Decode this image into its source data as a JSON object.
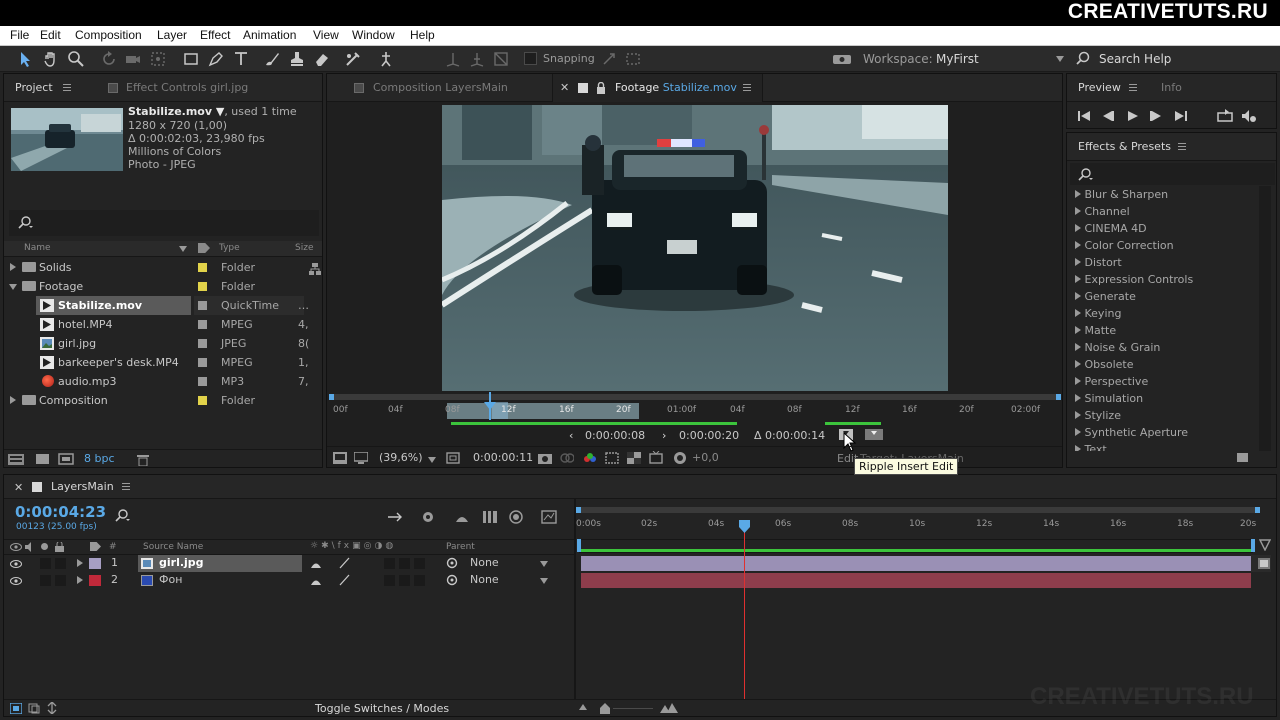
{
  "brand": "CREATIVETUTS.RU",
  "watermark": "CREATIVETUTS.RU",
  "menu": [
    "File",
    "Edit",
    "Composition",
    "Layer",
    "Effect",
    "Animation",
    "View",
    "Window",
    "Help"
  ],
  "toolbar": {
    "snapping": "Snapping",
    "workspace_label": "Workspace:",
    "workspace_value": "MyFirst",
    "search_help": "Search Help"
  },
  "project": {
    "tab_project": "Project",
    "tab_effect_controls": "Effect Controls girl.jpg",
    "selected_name": "Stabilize.mov ▼",
    "used": ", used 1 time",
    "info_lines": [
      "1280 x 720 (1,00)",
      "Δ 0:00:02:03, 23,980 fps",
      "Millions of Colors",
      "Photo - JPEG"
    ],
    "search_placeholder": "",
    "columns": {
      "name": "Name",
      "type": "Type",
      "size": "Size"
    },
    "items": [
      {
        "name": "Solids",
        "type": "Folder",
        "size": "",
        "kind": "folder",
        "expanded": false,
        "indent": 0,
        "label_color": "#e2d34a"
      },
      {
        "name": "Footage",
        "type": "Folder",
        "size": "",
        "kind": "folder",
        "expanded": true,
        "indent": 0,
        "label_color": "#e2d34a"
      },
      {
        "name": "Stabilize.mov",
        "type": "QuickTime",
        "size": "…",
        "kind": "video",
        "indent": 1,
        "label_color": "#9a9a9a",
        "selected": true
      },
      {
        "name": "hotel.MP4",
        "type": "MPEG",
        "size": "4,",
        "kind": "video",
        "indent": 1,
        "label_color": "#9a9a9a"
      },
      {
        "name": "girl.jpg",
        "type": "JPEG",
        "size": "8(",
        "kind": "image",
        "indent": 1,
        "label_color": "#9a9a9a"
      },
      {
        "name": "barkeeper's desk.MP4",
        "type": "MPEG",
        "size": "1,",
        "kind": "video",
        "indent": 1,
        "label_color": "#9a9a9a"
      },
      {
        "name": "audio.mp3",
        "type": "MP3",
        "size": "7,",
        "kind": "audio",
        "indent": 1,
        "label_color": "#9a9a9a"
      },
      {
        "name": "Composition",
        "type": "Folder",
        "size": "",
        "kind": "folder",
        "expanded": false,
        "indent": 0,
        "label_color": "#e2d34a"
      }
    ],
    "bpc": "8 bpc"
  },
  "viewer": {
    "tab_composition": "Composition LayersMain",
    "tab_footage_prefix": "Footage",
    "tab_footage_name": "Stabilize.mov",
    "ruler_ticks": [
      "00f",
      "04f",
      "08f",
      "12f",
      "16f",
      "20f",
      "01:00f",
      "04f",
      "08f",
      "12f",
      "16f",
      "20f",
      "02:00f"
    ],
    "in_point": "0:00:00:08",
    "out_point": "0:00:00:20",
    "duration": "Δ 0:00:00:14",
    "zoom": "(39,6%)",
    "timecode": "0:00:00:11",
    "exposure": "+0,0",
    "edit_label": "Edit",
    "edit_target": "Target: LayersMain",
    "tooltip": "Ripple Insert Edit"
  },
  "preview": {
    "tab_preview": "Preview",
    "tab_info": "Info"
  },
  "effects": {
    "title": "Effects & Presets",
    "search_placeholder": "",
    "items": [
      "Blur & Sharpen",
      "Channel",
      "CINEMA 4D",
      "Color Correction",
      "Distort",
      "Expression Controls",
      "Generate",
      "Keying",
      "Matte",
      "Noise & Grain",
      "Obsolete",
      "Perspective",
      "Simulation",
      "Stylize",
      "Synthetic Aperture",
      "Text"
    ]
  },
  "timeline": {
    "comp_name": "LayersMain",
    "current_time": "0:00:04:23",
    "frame_info": "00123 (25.00 fps)",
    "columns": {
      "source": "Source Name",
      "parent": "Parent"
    },
    "layers": [
      {
        "num": "1",
        "name": "girl.jpg",
        "parent": "None",
        "label_color": "#a79fc4",
        "bar_color": "#9a90b5",
        "kind": "image",
        "selected": true
      },
      {
        "num": "2",
        "name": "Фон",
        "parent": "None",
        "label_color": "#c0293a",
        "bar_color": "#8e3d4c",
        "kind": "solid",
        "selected": false
      }
    ],
    "ruler": [
      "0:00s",
      "02s",
      "04s",
      "06s",
      "08s",
      "10s",
      "12s",
      "14s",
      "16s",
      "18s",
      "20s"
    ],
    "toggle_label": "Toggle Switches / Modes"
  }
}
